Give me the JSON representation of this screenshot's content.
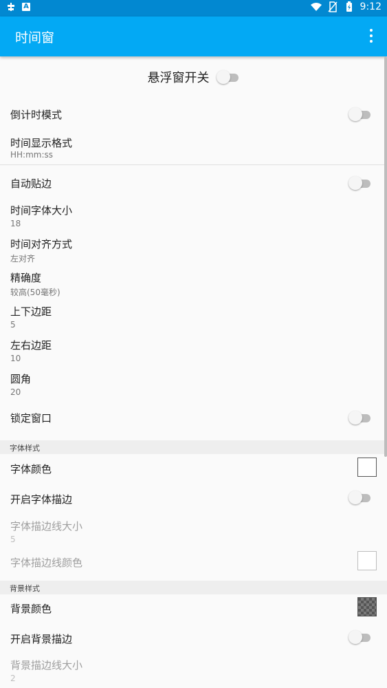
{
  "status_bar": {
    "left_icons": [
      "bug-notification-icon",
      "a-notification-icon"
    ],
    "right_icons": [
      "wifi-icon",
      "no-sim-icon",
      "battery-charging-icon"
    ],
    "time": "9:12"
  },
  "app_bar": {
    "title": "时间窗",
    "menu_icon": "more-vert-icon"
  },
  "master_toggle": {
    "label": "悬浮窗开关",
    "on": false
  },
  "items": [
    {
      "title": "倒计时模式",
      "type": "switch",
      "on": false
    },
    {
      "title": "时间显示格式",
      "summary": "HH:mm:ss"
    },
    {
      "title": "自动贴边",
      "type": "switch",
      "on": false
    },
    {
      "title": "时间字体大小",
      "summary": "18"
    },
    {
      "title": "时间对齐方式",
      "summary": "左对齐"
    },
    {
      "title": "精确度",
      "summary": "较高(50毫秒)"
    },
    {
      "title": "上下边距",
      "summary": "5"
    },
    {
      "title": "左右边距",
      "summary": "10"
    },
    {
      "title": "圆角",
      "summary": "20"
    },
    {
      "title": "锁定窗口",
      "type": "switch",
      "on": false
    }
  ],
  "font_section": {
    "header": "字体样式",
    "items": [
      {
        "title": "字体颜色",
        "type": "color",
        "color": "#ffffff"
      },
      {
        "title": "开启字体描边",
        "type": "switch",
        "on": false
      },
      {
        "title": "字体描边线大小",
        "summary": "5",
        "enabled": false
      },
      {
        "title": "字体描边线颜色",
        "type": "color",
        "color": "#ffffff",
        "enabled": false
      }
    ]
  },
  "background_section": {
    "header": "背景样式",
    "items": [
      {
        "title": "背景颜色",
        "type": "color",
        "color": "transparent-checker"
      },
      {
        "title": "开启背景描边",
        "type": "switch",
        "on": false
      },
      {
        "title": "背景描边线大小",
        "summary": "2",
        "enabled": false
      }
    ]
  },
  "colors": {
    "status_bar": "#0288d1",
    "app_bar": "#03a9f4",
    "section_bg": "#eeeeee"
  }
}
